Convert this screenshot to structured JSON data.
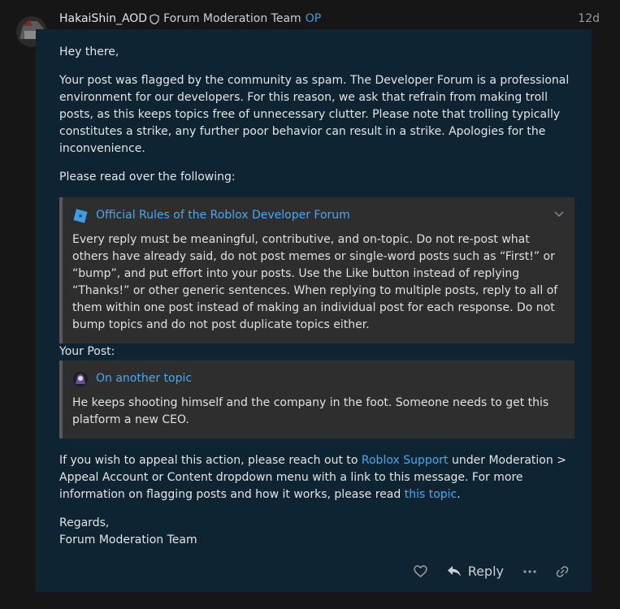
{
  "post": {
    "username": "HakaiShin_AOD",
    "group": "Forum Moderation Team",
    "op_badge": "OP",
    "age": "12d",
    "greeting": "Hey there,",
    "body": "Your post was flagged by the community as spam. The Developer Forum is a professional environment for our developers. For this reason, we ask that refrain from making troll posts, as this keeps topics free of unnecessary clutter. Please note that trolling typically constitutes a strike, any further poor behavior can result in a strike. Apologies for the inconvenience.",
    "read_over": "Please read over the following:",
    "rules_box": {
      "title": "Official Rules of the Roblox Developer Forum",
      "text": "Every reply must be meaningful, contributive, and on-topic. Do not re-post what others have already said, do not post memes or single-word posts such as “First!” or “bump”, and put effort into your posts. Use the Like button instead of replying “Thanks!” or other generic sentences. When replying to multiple posts, reply to all of them within one post instead of making an individual post for each response. Do not bump topics and do not post duplicate topics either."
    },
    "your_post_label": "Your Post:",
    "quote_box": {
      "title": "On another topic",
      "text": "He keeps shooting himself and the company in the foot. Someone needs to get this platform a new CEO."
    },
    "appeal": {
      "part1": "If you wish to appeal this action, please reach out to ",
      "link1": "Roblox Support",
      "part2": " under Moderation > Appeal Account or Content dropdown menu with a link to this message. For more information on flagging posts and how it works, please read ",
      "link2": "this topic",
      "part3": "."
    },
    "regards": "Regards,",
    "signature": "Forum Moderation Team"
  },
  "actions": {
    "reply_label": "Reply"
  },
  "colors": {
    "post_bg": "#0e2433",
    "link": "#4aa8f0",
    "box_bg": "#2e2e2e"
  },
  "icons": [
    "shield-icon",
    "roblox-logo-icon",
    "chevron-down-icon",
    "heart-icon",
    "reply-icon",
    "more-icon",
    "link-icon"
  ]
}
